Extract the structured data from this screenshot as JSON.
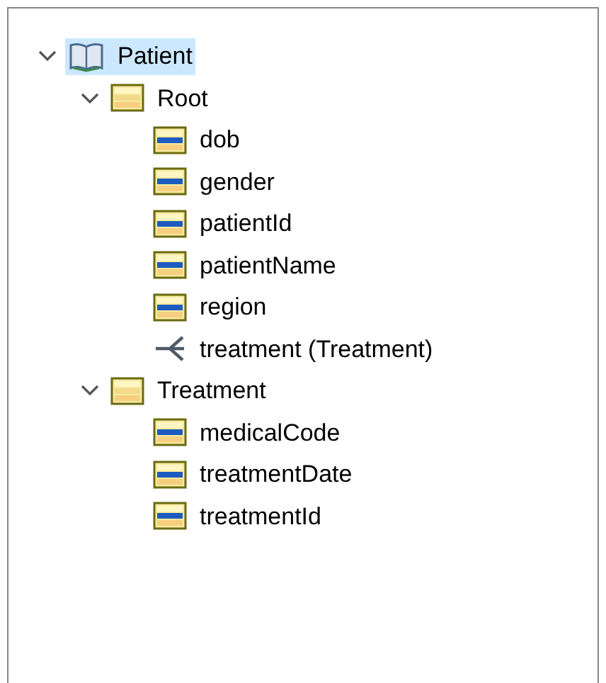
{
  "tree": [
    {
      "label": "Patient",
      "kind": "model",
      "selected": true,
      "expanded": true,
      "children": [
        {
          "label": "Root",
          "kind": "table",
          "selected": false,
          "expanded": true,
          "children": [
            {
              "label": "dob",
              "kind": "field",
              "selected": false
            },
            {
              "label": "gender",
              "kind": "field",
              "selected": false
            },
            {
              "label": "patientId",
              "kind": "field",
              "selected": false
            },
            {
              "label": "patientName",
              "kind": "field",
              "selected": false
            },
            {
              "label": "region",
              "kind": "field",
              "selected": false
            },
            {
              "label": "treatment (Treatment)",
              "kind": "reference",
              "selected": false
            }
          ]
        },
        {
          "label": "Treatment",
          "kind": "table",
          "selected": false,
          "expanded": true,
          "children": [
            {
              "label": "medicalCode",
              "kind": "field",
              "selected": false
            },
            {
              "label": "treatmentDate",
              "kind": "field",
              "selected": false
            },
            {
              "label": "treatmentId",
              "kind": "field",
              "selected": false
            }
          ]
        }
      ]
    }
  ]
}
